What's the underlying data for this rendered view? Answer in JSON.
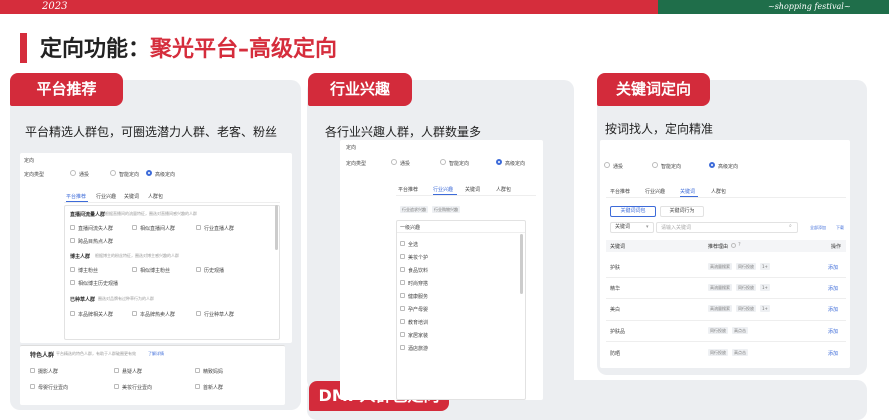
{
  "header": {
    "year": "2023",
    "festival": "~shopping festival~"
  },
  "page_title": {
    "prefix": "定向功能：",
    "emphasis": "聚光平台–高级定向"
  },
  "cards": {
    "platform": {
      "tag": "平台推荐",
      "desc": "平台精选人群包，可圈选潜力人群、老客、粉丝",
      "ui": {
        "section_label": "定向",
        "type_label": "定向类型",
        "radios": [
          "通投",
          "智能定向",
          "高级定向"
        ],
        "tabs": [
          "平台推荐",
          "行业兴趣",
          "关键词",
          "人群包"
        ],
        "groups": [
          {
            "title": "直播间流量人群",
            "note": "根据直播间的流量特征，圈选对直播间感兴趣的人群",
            "items": [
              "直播间流失人群",
              "相似直播间人群",
              "行业直播人群",
              "跨品目热点人群"
            ]
          },
          {
            "title": "博主人群",
            "note": "根据博主的粉丝特征，圈选对博主感兴趣的人群",
            "items": [
              "博主粉丝",
              "相似博主粉丝",
              "历史观播",
              "相似博主历史观播"
            ]
          },
          {
            "title": "已种草人群",
            "note": "圈选对品牌有过种草行为的人群",
            "items": [
              "本品牌相关人群",
              "本品牌热卖人群",
              "行业种草人群"
            ]
          }
        ],
        "special_title": "特色人群",
        "special_note": "平台精选的特色人群，有助于人群破圈更有效",
        "special_link": "了解详情",
        "special_items": [
          "摄影人群",
          "悬疑人群",
          "精致妈妈",
          "母婴行业壹向",
          "美妆行业壹向",
          "首新人群"
        ]
      }
    },
    "industry": {
      "tag": "行业兴趣",
      "desc": "各行业兴趣人群，人群数量多",
      "ui": {
        "section_label": "定向",
        "type_label": "定向类型",
        "radios": [
          "通投",
          "智能定向",
          "高级定向"
        ],
        "tabs": [
          "平台推荐",
          "行业兴趣",
          "关键词",
          "人群包"
        ],
        "subtabs": [
          "行业追求兴趣",
          "行业购物兴趣"
        ],
        "list_title": "一级兴趣",
        "items": [
          "全选",
          "美妆个护",
          "食品饮料",
          "时尚穿搭",
          "健康服务",
          "孕产母婴",
          "教育培训",
          "家居家装",
          "酒店旅游"
        ]
      }
    },
    "keyword": {
      "tag": "关键词定向",
      "desc": "按词找人，定向精准",
      "ui": {
        "radios": [
          "通投",
          "智能定向",
          "高级定向"
        ],
        "tabs": [
          "平台推荐",
          "行业兴趣",
          "关键词",
          "人群包"
        ],
        "buttons": [
          "关键词词包",
          "关键词行为"
        ],
        "select_value": "关键词",
        "input_placeholder": "请输入关键词",
        "links": [
          "全部添加",
          "下载"
        ],
        "columns": [
          "关键词",
          "推荐理由",
          "操作"
        ],
        "rows": [
          {
            "kw": "护肤",
            "reasons": [
              "高流量搜索",
              "同行投放",
              "1+"
            ],
            "op": "添加"
          },
          {
            "kw": "精华",
            "reasons": [
              "高流量搜索",
              "同行投放",
              "1+"
            ],
            "op": "添加"
          },
          {
            "kw": "美白",
            "reasons": [
              "高流量搜索",
              "同行投放",
              "1+"
            ],
            "op": "添加"
          },
          {
            "kw": "护肤品",
            "reasons": [
              "同行投放",
              "高点击"
            ],
            "op": "添加"
          },
          {
            "kw": "防晒",
            "reasons": [
              "同行投放",
              "高点击"
            ],
            "op": "添加"
          }
        ]
      }
    },
    "dmp": {
      "tag": "DMP人群包定向"
    }
  },
  "colors": {
    "brand_red": "#d52d3c",
    "festival_green": "#1f6e4a",
    "link_blue": "#3d6bd9"
  }
}
